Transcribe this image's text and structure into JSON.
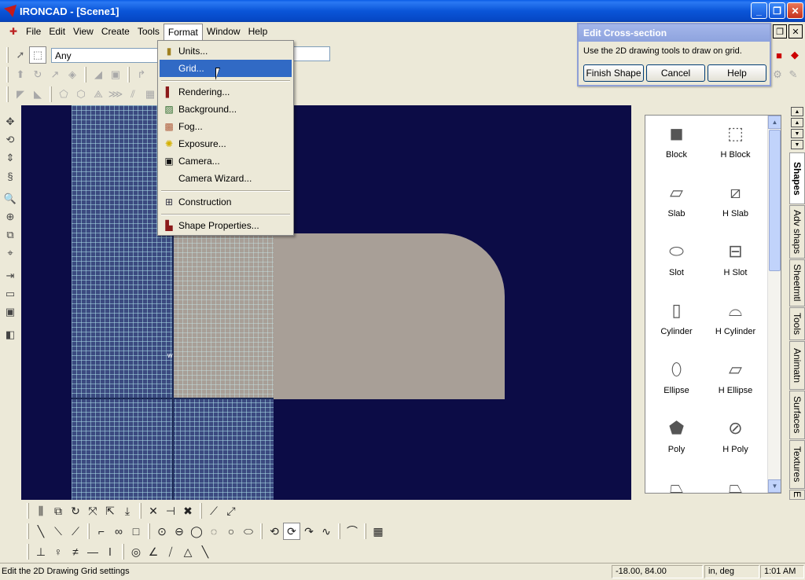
{
  "window": {
    "title": "IRONCAD - [Scene1]",
    "minimize": "_",
    "restore": "❐",
    "close": "✕"
  },
  "menubar": {
    "items": [
      "File",
      "Edit",
      "View",
      "Create",
      "Tools",
      "Format",
      "Window",
      "Help"
    ],
    "active": "Format"
  },
  "toolbar": {
    "selection_filter": "Any"
  },
  "format_menu": {
    "items": [
      {
        "label": "Units...",
        "icon": "ruler-icon"
      },
      {
        "label": "Grid...",
        "icon": "",
        "highlighted": true
      },
      {
        "label": "Rendering...",
        "icon": "rendering-icon"
      },
      {
        "label": "Background...",
        "icon": "background-icon"
      },
      {
        "label": "Fog...",
        "icon": "fog-icon"
      },
      {
        "label": "Exposure...",
        "icon": "sun-icon"
      },
      {
        "label": "Camera...",
        "icon": "camera-icon"
      },
      {
        "label": "Camera Wizard...",
        "icon": ""
      },
      {
        "label": "Construction",
        "icon": "construction-icon"
      },
      {
        "label": "Shape Properties...",
        "icon": "shape-properties-icon"
      }
    ]
  },
  "cross_section_dialog": {
    "title": "Edit Cross-section",
    "instruction": "Use the 2D drawing tools to draw on grid.",
    "finish_label": "Finish Shape",
    "cancel_label": "Cancel",
    "help_label": "Help"
  },
  "viewport": {
    "origin_label": "w"
  },
  "catalog": {
    "items": [
      "Block",
      "H Block",
      "Slab",
      "H Slab",
      "Slot",
      "H Slot",
      "Cylinder",
      "H Cylinder",
      "Ellipse",
      "H Ellipse",
      "Poly",
      "H Poly"
    ],
    "tabs": [
      "Shapes",
      "Adv shaps",
      "Sheetmtl",
      "Tools",
      "Animatn",
      "Surfaces",
      "Textures",
      "E"
    ],
    "active_tab": "Shapes"
  },
  "statusbar": {
    "message": "Edit the 2D Drawing Grid settings",
    "coordinates": "-18.00, 84.00",
    "units": "in, deg",
    "clock": "1:01 AM"
  },
  "colors": {
    "viewport_bg": "#0c0c46",
    "shape_face": "#a89f97",
    "menu_highlight": "#316ac5",
    "titlebar": "#0a55d8"
  }
}
